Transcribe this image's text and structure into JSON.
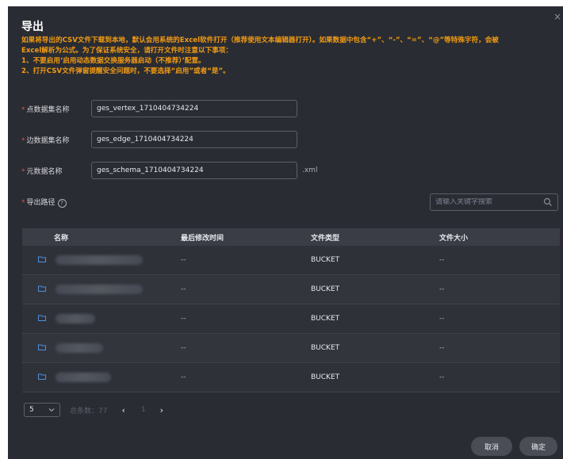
{
  "dialog": {
    "title": "导出",
    "close": "×",
    "warning_lines": [
      "如果将导出的CSV文件下载到本地，默认会用系统的Excel软件打开（推荐使用文本编辑器打开）。如果数据中包含“+”、“-”、“=”、“@”等特殊字符，会被",
      "Excel解析为公式。为了保证系统安全，请打开文件时注意以下事项：",
      "1、不要启用‘启用动态数据交换服务器启动（不推荐）’配置。",
      "2、打开CSV文件弹窗提醒安全问题时，不要选择“启用”或者“是”。"
    ]
  },
  "form": {
    "required_mark": "*",
    "vertex_label": "点数据集名称",
    "vertex_value": "ges_vertex_1710404734224",
    "edge_label": "边数据集名称",
    "edge_value": "ges_edge_1710404734224",
    "schema_label": "元数据名称",
    "schema_value": "ges_schema_1710404734224",
    "schema_suffix": ".xml",
    "path_label": "导出路径",
    "help_icon": "?"
  },
  "search": {
    "placeholder": "请输入关键字搜索",
    "icon": "search-icon"
  },
  "table": {
    "headers": [
      "名称",
      "最后修改时间",
      "文件类型",
      "文件大小"
    ],
    "rows": [
      {
        "modified": "--",
        "type": "BUCKET",
        "size": "--"
      },
      {
        "modified": "--",
        "type": "BUCKET",
        "size": "--"
      },
      {
        "modified": "--",
        "type": "BUCKET",
        "size": "--"
      },
      {
        "modified": "--",
        "type": "BUCKET",
        "size": "--"
      },
      {
        "modified": "--",
        "type": "BUCKET",
        "size": "--"
      }
    ]
  },
  "pagination": {
    "page_size": "5",
    "total": "总条数：77",
    "current_page": "1"
  },
  "actions": {
    "cancel": "取消",
    "confirm": "确定"
  },
  "colors": {
    "background": "#2a2c33",
    "warning": "#f39c12",
    "required": "#e5484d",
    "folder": "#4a90e2"
  }
}
